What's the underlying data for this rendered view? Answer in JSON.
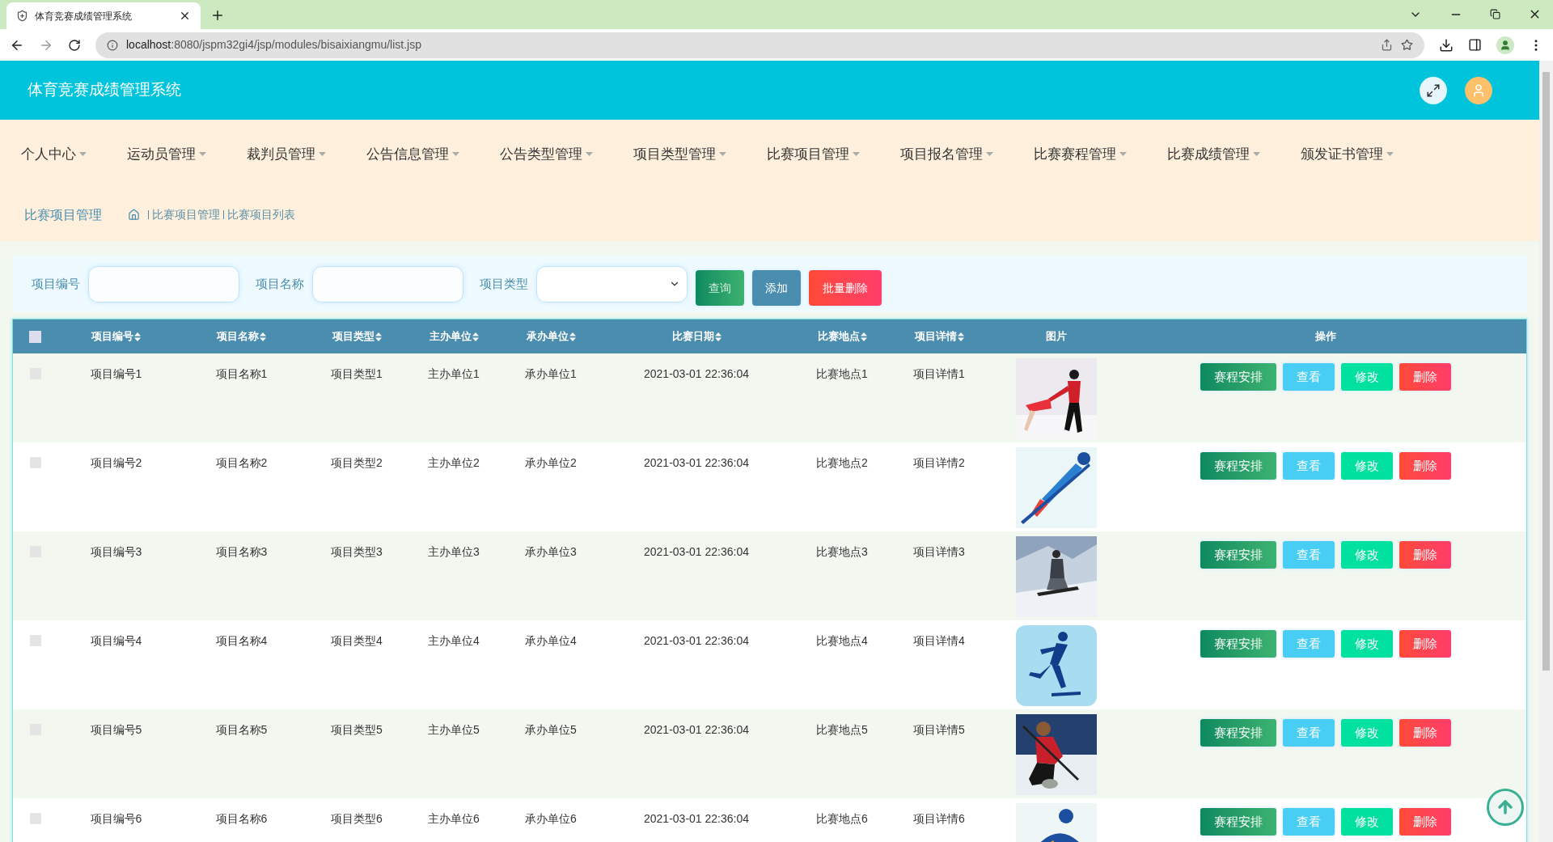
{
  "browser": {
    "tab_title": "体育竞赛成绩管理系统",
    "url_host": "localhost",
    "url_rest": ":8080/jspm32gi4/jsp/modules/bisaixiangmu/list.jsp"
  },
  "header": {
    "title": "体育竞赛成绩管理系统"
  },
  "nav": [
    {
      "label": "个人中心"
    },
    {
      "label": "运动员管理"
    },
    {
      "label": "裁判员管理"
    },
    {
      "label": "公告信息管理"
    },
    {
      "label": "公告类型管理"
    },
    {
      "label": "项目类型管理"
    },
    {
      "label": "比赛项目管理"
    },
    {
      "label": "项目报名管理"
    },
    {
      "label": "比赛赛程管理"
    },
    {
      "label": "比赛成绩管理"
    },
    {
      "label": "颁发证书管理"
    }
  ],
  "breadcrumb": {
    "title": "比赛项目管理",
    "path": [
      "比赛项目管理",
      "比赛项目列表"
    ]
  },
  "search": {
    "fields": [
      {
        "label": "项目编号",
        "kind": "input"
      },
      {
        "label": "项目名称",
        "kind": "input"
      },
      {
        "label": "项目类型",
        "kind": "select"
      }
    ],
    "buttons": [
      {
        "label": "查询",
        "kind": "query"
      },
      {
        "label": "添加",
        "kind": "add"
      },
      {
        "label": "批量删除",
        "kind": "delete"
      }
    ]
  },
  "table": {
    "select_all_checked": false,
    "columns": [
      {
        "label": "项目编号",
        "sortable": true
      },
      {
        "label": "项目名称",
        "sortable": true
      },
      {
        "label": "项目类型",
        "sortable": true
      },
      {
        "label": "主办单位",
        "sortable": true
      },
      {
        "label": "承办单位",
        "sortable": true
      },
      {
        "label": "比赛日期",
        "sortable": true
      },
      {
        "label": "比赛地点",
        "sortable": true
      },
      {
        "label": "项目详情",
        "sortable": true
      },
      {
        "label": "图片",
        "sortable": false
      },
      {
        "label": "操作",
        "sortable": false
      }
    ],
    "rows": [
      {
        "checked": false,
        "cells": [
          "项目编号1",
          "项目名称1",
          "项目类型1",
          "主办单位1",
          "承办单位1",
          "2021-03-01 22:36:04",
          "比赛地点1",
          "项目详情1"
        ],
        "actions": [
          {
            "label": "赛程安排",
            "kind": "schedule"
          },
          {
            "label": "查看",
            "kind": "view"
          },
          {
            "label": "修改",
            "kind": "edit"
          },
          {
            "label": "删除",
            "kind": "delete"
          }
        ]
      },
      {
        "checked": false,
        "cells": [
          "项目编号2",
          "项目名称2",
          "项目类型2",
          "主办单位2",
          "承办单位2",
          "2021-03-01 22:36:04",
          "比赛地点2",
          "项目详情2"
        ],
        "actions": [
          {
            "label": "赛程安排",
            "kind": "schedule"
          },
          {
            "label": "查看",
            "kind": "view"
          },
          {
            "label": "修改",
            "kind": "edit"
          },
          {
            "label": "删除",
            "kind": "delete"
          }
        ]
      },
      {
        "checked": false,
        "cells": [
          "项目编号3",
          "项目名称3",
          "项目类型3",
          "主办单位3",
          "承办单位3",
          "2021-03-01 22:36:04",
          "比赛地点3",
          "项目详情3"
        ],
        "actions": [
          {
            "label": "赛程安排",
            "kind": "schedule"
          },
          {
            "label": "查看",
            "kind": "view"
          },
          {
            "label": "修改",
            "kind": "edit"
          },
          {
            "label": "删除",
            "kind": "delete"
          }
        ]
      },
      {
        "checked": false,
        "cells": [
          "项目编号4",
          "项目名称4",
          "项目类型4",
          "主办单位4",
          "承办单位4",
          "2021-03-01 22:36:04",
          "比赛地点4",
          "项目详情4"
        ],
        "actions": [
          {
            "label": "赛程安排",
            "kind": "schedule"
          },
          {
            "label": "查看",
            "kind": "view"
          },
          {
            "label": "修改",
            "kind": "edit"
          },
          {
            "label": "删除",
            "kind": "delete"
          }
        ]
      },
      {
        "checked": false,
        "cells": [
          "项目编号5",
          "项目名称5",
          "项目类型5",
          "主办单位5",
          "承办单位5",
          "2021-03-01 22:36:04",
          "比赛地点5",
          "项目详情5"
        ],
        "actions": [
          {
            "label": "赛程安排",
            "kind": "schedule"
          },
          {
            "label": "查看",
            "kind": "view"
          },
          {
            "label": "修改",
            "kind": "edit"
          },
          {
            "label": "删除",
            "kind": "delete"
          }
        ]
      },
      {
        "checked": false,
        "cells": [
          "项目编号6",
          "项目名称6",
          "项目类型6",
          "主办单位6",
          "承办单位6",
          "2021-03-01 22:36:04",
          "比赛地点6",
          "项目详情6"
        ],
        "actions": [
          {
            "label": "赛程安排",
            "kind": "schedule"
          },
          {
            "label": "查看",
            "kind": "view"
          },
          {
            "label": "修改",
            "kind": "edit"
          },
          {
            "label": "删除",
            "kind": "delete"
          }
        ]
      }
    ]
  }
}
